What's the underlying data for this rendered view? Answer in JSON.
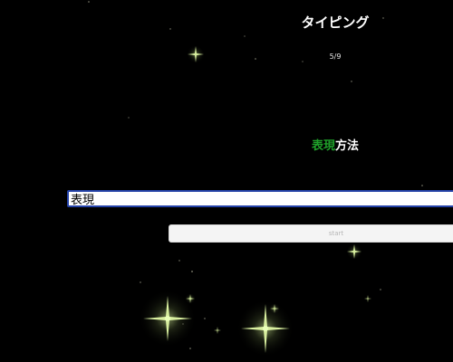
{
  "header": {
    "title": "タイピング",
    "progress_text": "5/9"
  },
  "word": {
    "typed": "表現",
    "remaining": "方法"
  },
  "input": {
    "value": "表現"
  },
  "start_button": {
    "label": "start"
  },
  "colors": {
    "background": "#000000",
    "typed_text": "#1fa12a",
    "remaining_text": "#ffffff",
    "input_border": "#2442a8",
    "sparkle": "#d9f0a0"
  }
}
